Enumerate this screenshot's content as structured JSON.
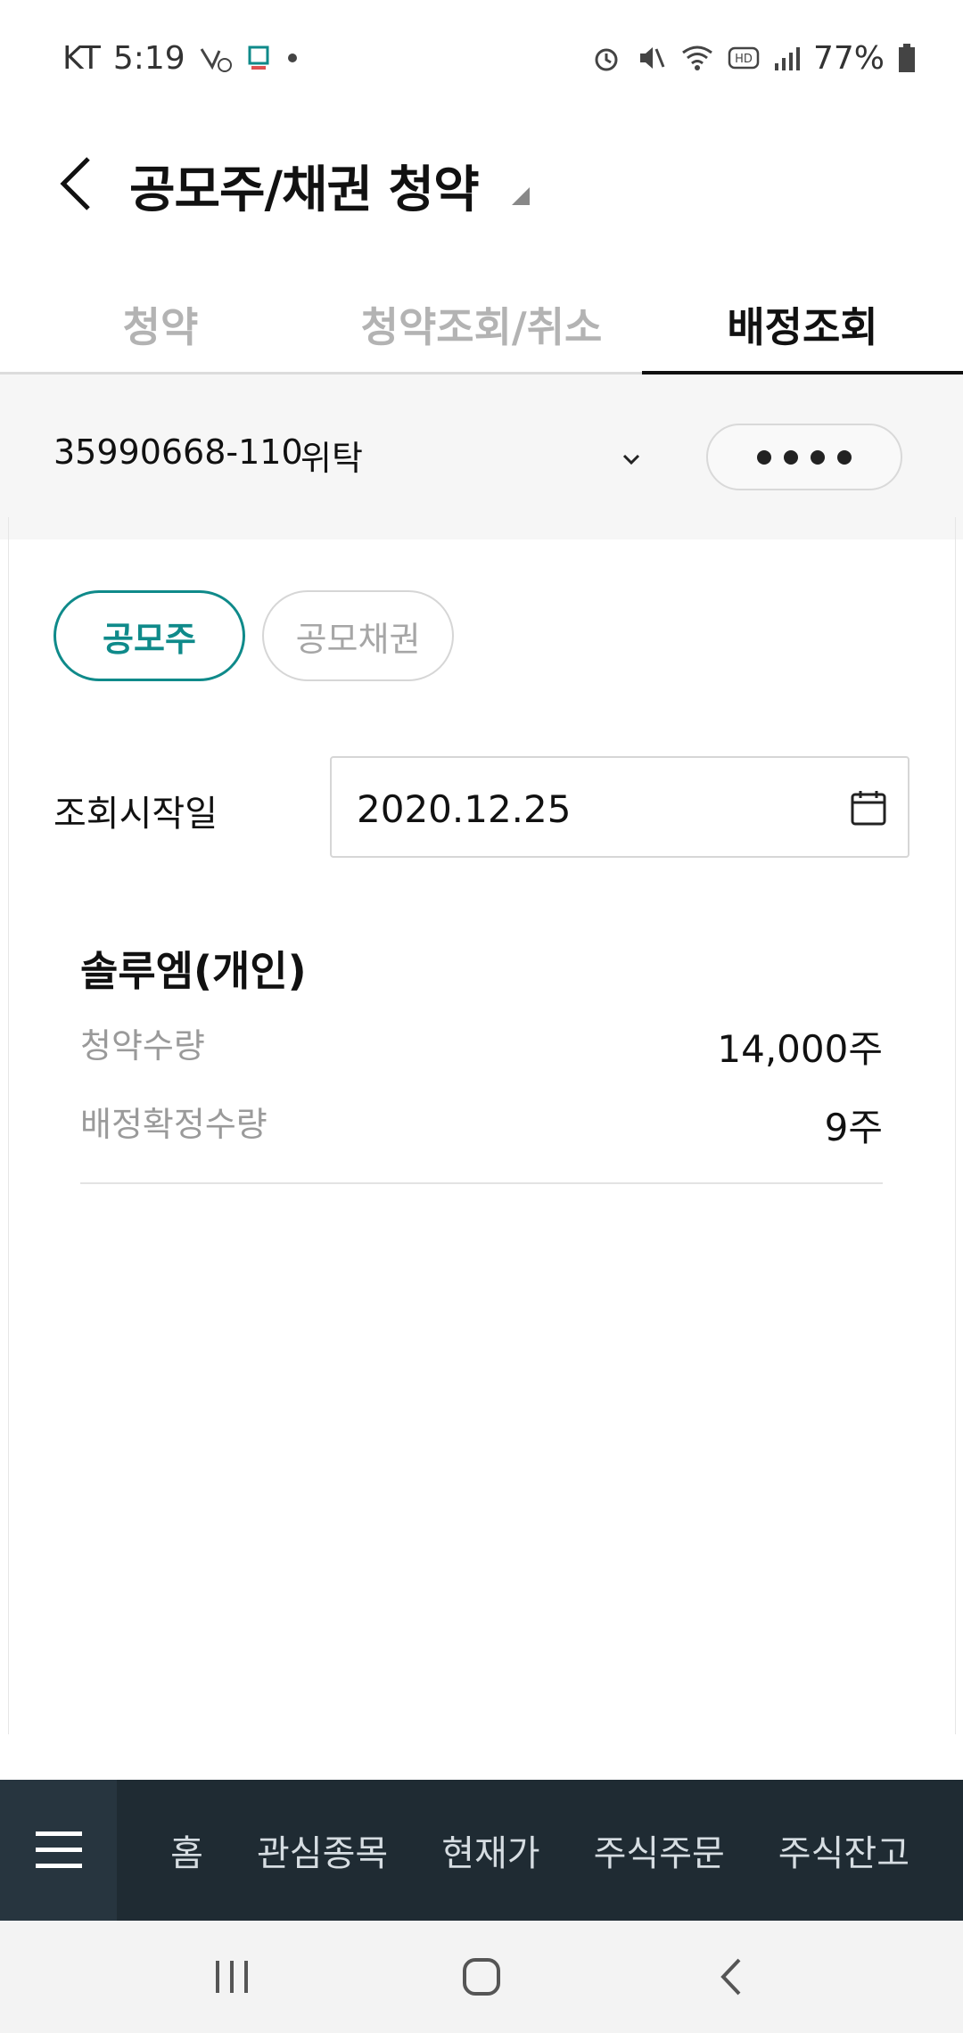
{
  "status_bar": {
    "carrier": "KT",
    "time": "5:19",
    "battery": "77%",
    "icons": [
      "missed-call-icon",
      "app-notification-icon",
      "dot-icon",
      "alarm-icon",
      "mute-icon",
      "wifi-icon",
      "hd-icon",
      "signal-icon",
      "battery-icon"
    ]
  },
  "header": {
    "title": "공모주/채권 청약"
  },
  "tabs": [
    {
      "label": "청약",
      "active": false
    },
    {
      "label": "청약조회/취소",
      "active": false
    },
    {
      "label": "배정조회",
      "active": true
    }
  ],
  "account": {
    "number": "35990668-110",
    "type": "위탁"
  },
  "filters": {
    "ipo_label": "공모주",
    "bond_label": "공모채권"
  },
  "query": {
    "start_date_label": "조회시작일",
    "start_date_value": "2020.12.25"
  },
  "result": {
    "name": "솔루엠(개인)",
    "rows": [
      {
        "label": "청약수량",
        "value": "14,000주"
      },
      {
        "label": "배정확정수량",
        "value": "9주"
      }
    ]
  },
  "bottom_nav": {
    "items": [
      "홈",
      "관심종목",
      "현재가",
      "주식주문",
      "주식잔고"
    ]
  },
  "colors": {
    "accent": "#0f8a8a",
    "nav_bg": "#1f2b33"
  }
}
